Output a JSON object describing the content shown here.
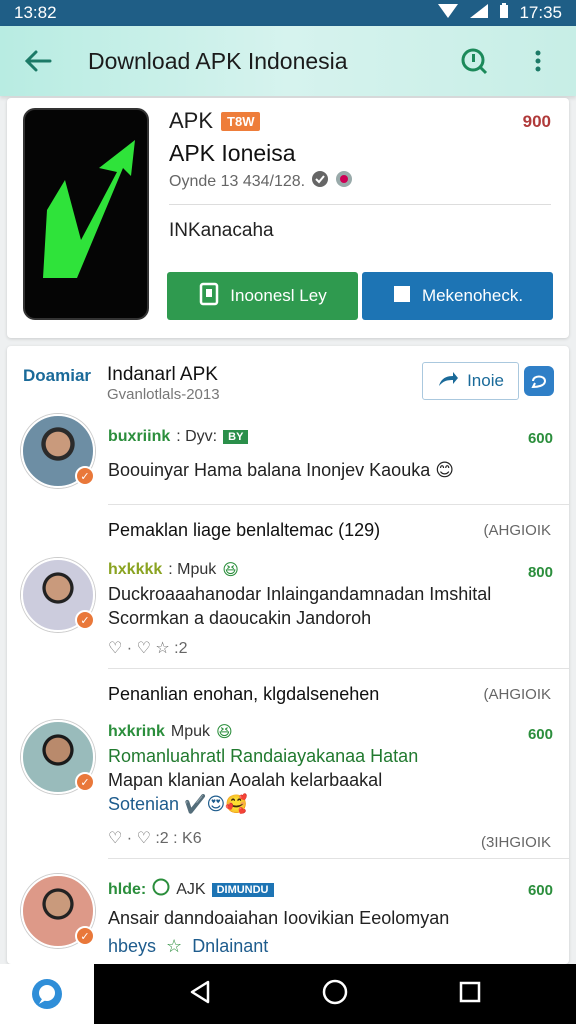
{
  "status_bar": {
    "time_left": "13:82",
    "time_right": "17:35"
  },
  "app_bar": {
    "title": "Download APK Indonesia"
  },
  "app_card": {
    "short_name": "APK",
    "badge": "T8W",
    "count": "900",
    "title": "APK Ioneisa",
    "meta": "Oynde 13 434/128.",
    "developer": "INKanacaha",
    "install_label": "Inoonesl Ley",
    "secondary_label": "Mekenoheck."
  },
  "reviews": {
    "section_label": "Doamiar",
    "title": "Indanarl APK",
    "subtitle": "Gvanlotlals-2013",
    "invite_label": "Inoie",
    "items": [
      {
        "stars_text": "buxriink",
        "rest": ": Dyv:",
        "badge": "BY",
        "score": "600",
        "text": "Boouinyar Hama balana Inonjev Kaouka"
      },
      {
        "headline": "Pemaklan liage benlaltemac (129)",
        "date": "(AHGIOIK",
        "stars_text": "hxkkkk",
        "rest": ": Mpuk",
        "score": "800",
        "text1": "Duckroaaahanodar Inlaingandamnadan Imshital",
        "text2": "Scormkan a daoucakin Jandoroh",
        "actions": "♡ ·   ♡ ☆ :2"
      },
      {
        "headline": "Penanlian enohan, klgdalsenehen",
        "date": "(AHGIOIK",
        "stars_text": "hxkrink",
        "rest": "Mpuk",
        "score": "600",
        "text1": "Romanluahratl Randaiayakanaa Hatan",
        "text2": "Mapan klanian Aoalah kelarbaakal",
        "text3": "Sotenian",
        "actions": "♡ ·   ♡ :2 : K6",
        "date2": "(3IHGIOIK"
      },
      {
        "stars_text": "hlde:",
        "rest": "AJK",
        "badge": "DIMUNDU",
        "score": "600",
        "text1": "Ansair danndoaiahan Ioovikian Eeolomyan",
        "text2": "hbeys",
        "text3": "Dnlainant"
      }
    ]
  }
}
